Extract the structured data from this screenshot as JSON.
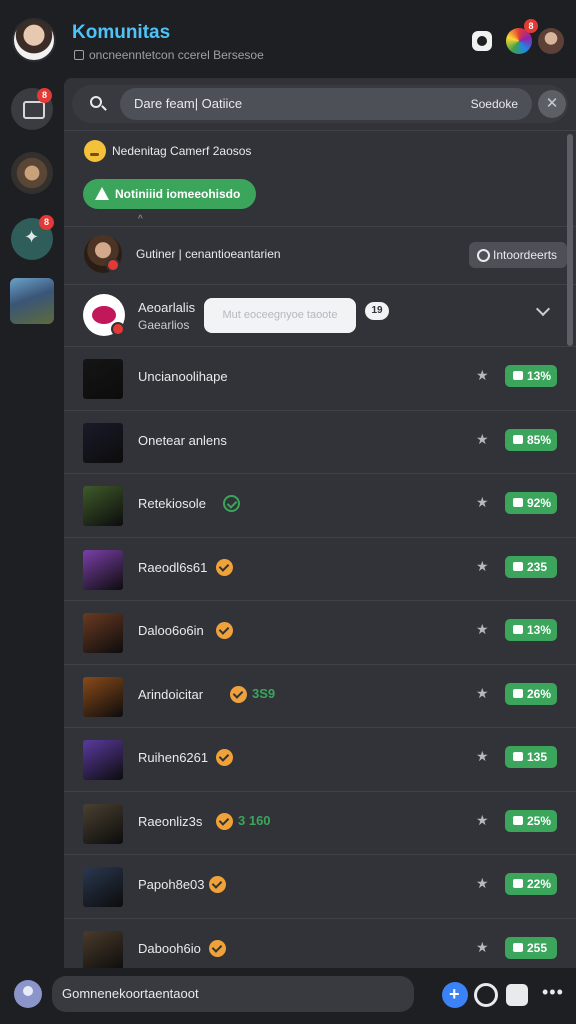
{
  "header": {
    "title": "Komunitas",
    "subtitle": "oncneenntetcon ccerel Bersesoe",
    "notification_count": "8"
  },
  "rail": {
    "badges": [
      "8",
      "",
      "8",
      ""
    ]
  },
  "search": {
    "value": "Dare feam| Oatiice",
    "right_label": "Soedoke",
    "close_glyph": "✕"
  },
  "notice": {
    "text": "Nedenitag Camerf 2aosos",
    "banner_label": "Notiniiid iomeeohisdo",
    "caret": "^"
  },
  "member": {
    "text": "Gutiner | cenantioeantarien",
    "button_label": "Intoordeerts"
  },
  "group": {
    "name": "Aeoarlalis",
    "subtitle": "Gaearlios",
    "tooltip": "Mut eoceegnyoe taoote",
    "count": "19"
  },
  "games": [
    {
      "title": "Uncianoolihape",
      "extra": "",
      "verified": "none",
      "percent": "13%",
      "thumb": "#151515"
    },
    {
      "title": "Onetear anlens",
      "extra": "",
      "verified": "none",
      "percent": "85%",
      "thumb": "#1a1a2a"
    },
    {
      "title": "Retekiosole",
      "extra": "",
      "verified": "green",
      "percent": "92%",
      "thumb": "#3f5a2a"
    },
    {
      "title": "Raeodl6s61",
      "extra": "",
      "verified": "orange",
      "percent": "235",
      "thumb": "#7a3fa8"
    },
    {
      "title": "Daloo6o6in",
      "extra": "",
      "verified": "orange",
      "percent": "13%",
      "thumb": "#6a3a22"
    },
    {
      "title": "Arindoicitar",
      "extra": "3S9",
      "verified": "orange",
      "percent": "26%",
      "thumb": "#8a4a1a"
    },
    {
      "title": "Ruihen6261",
      "extra": "",
      "verified": "orange",
      "percent": "135",
      "thumb": "#5a3aa0"
    },
    {
      "title": "Raeonliz3s",
      "extra": "3 160",
      "verified": "orange",
      "percent": "25%",
      "thumb": "#4a4030"
    },
    {
      "title": "Papoh8e03",
      "extra": "",
      "verified": "orange",
      "percent": "22%",
      "thumb": "#2a3850"
    },
    {
      "title": "Dabooh6io",
      "extra": "",
      "verified": "orange",
      "percent": "255",
      "thumb": "#4a3a2a"
    }
  ],
  "footer": {
    "input_value": "Gomnenekoortaentaoot",
    "more": "•••"
  },
  "colors": {
    "accent": "#4fc3f7",
    "success": "#3ba55c",
    "danger": "#e53935",
    "verified": "#f0a23a"
  }
}
